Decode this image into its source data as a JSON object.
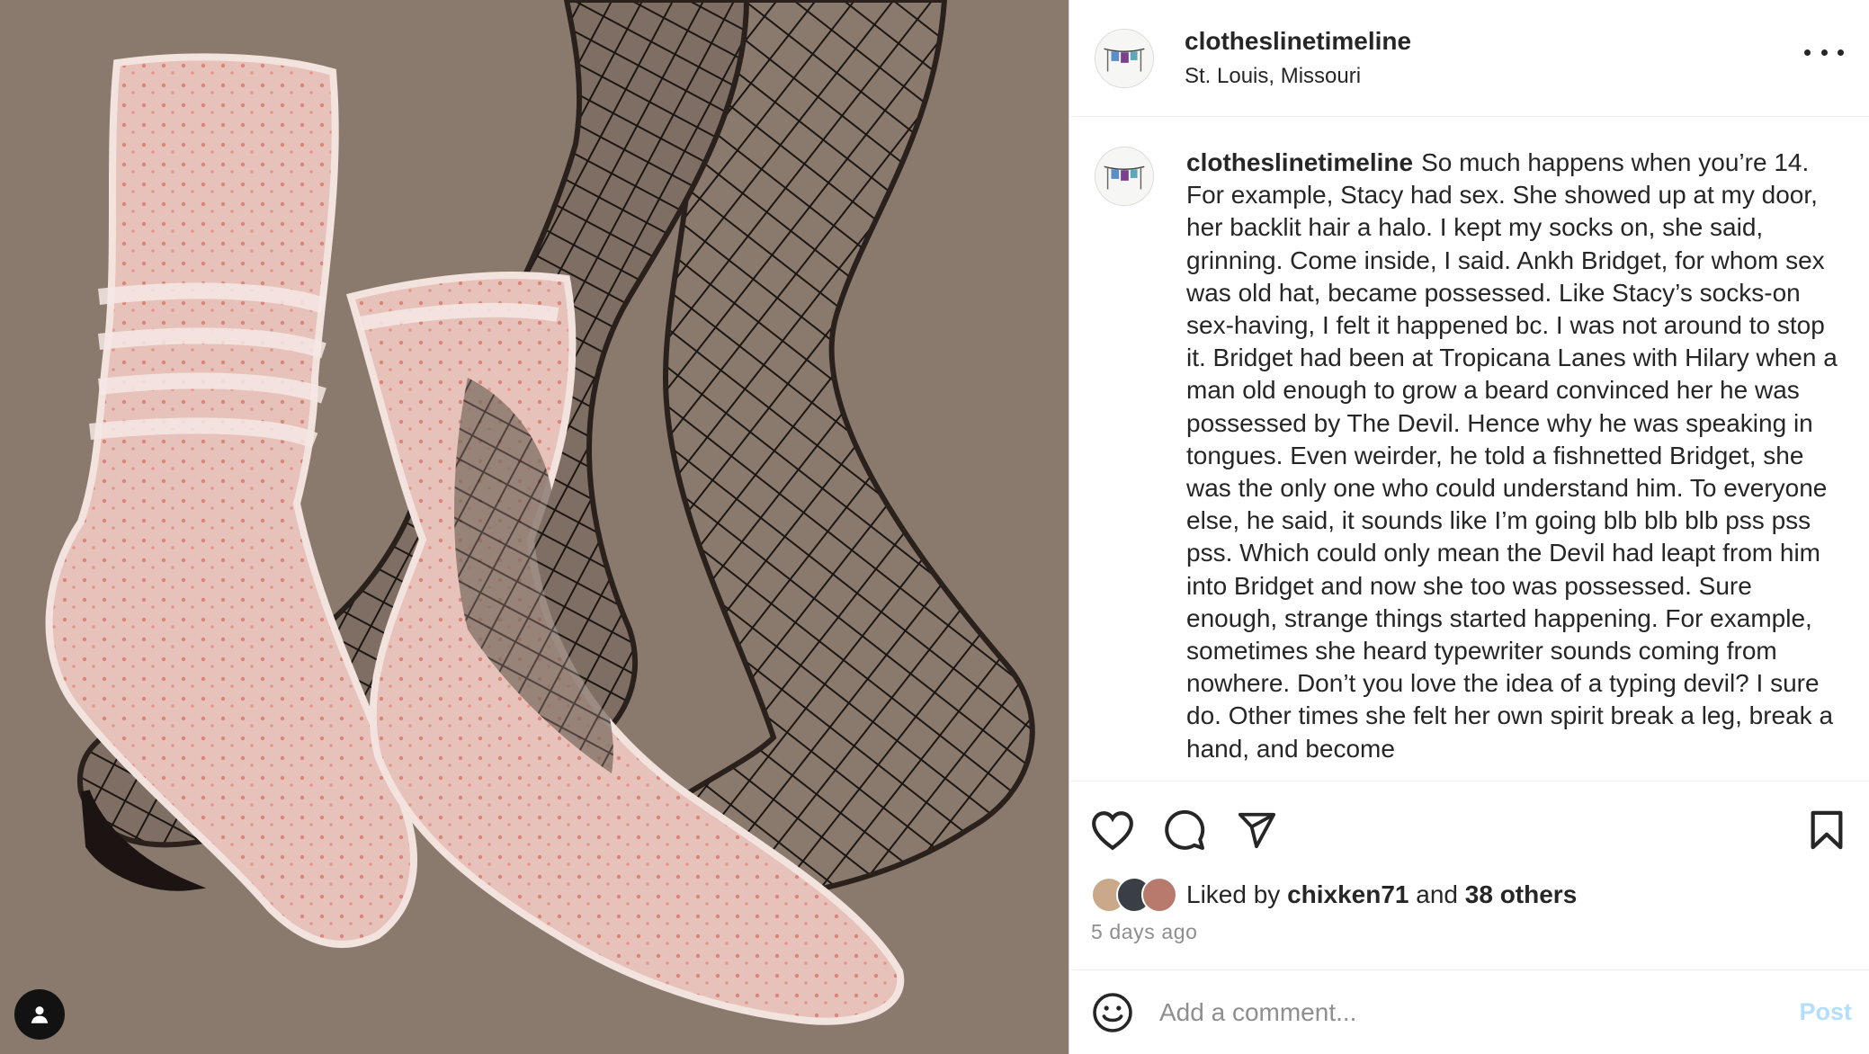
{
  "post": {
    "username": "clotheslinetimeline",
    "location": "St. Louis, Missouri",
    "more_icon": "more-horizontal-icon"
  },
  "caption": {
    "username": "clotheslinetimeline",
    "text": "So much happens when you’re 14. For example, Stacy had sex. She showed up at my door, her backlit hair a halo. I kept my socks on, she said, grinning. Come inside, I said. Ankh Bridget, for whom sex was old hat, became possessed. Like Stacy’s socks-on sex-having, I felt it happened bc. I was not around to stop it. Bridget had been at Tropicana Lanes with Hilary when a man old enough to grow a beard convinced her he was possessed by The Devil. Hence why he was speaking in tongues. Even weirder, he told a fishnetted Bridget, she was the only one who could understand him. To everyone else, he said, it sounds like I’m going blb blb blb pss pss pss. Which could only mean the Devil had leapt from him into Bridget and now she too was possessed. Sure enough, strange things started happening. For example, sometimes she heard typewriter sounds coming from nowhere. Don’t you love the idea of a typing devil? I sure do. Other times she felt her own spirit break a leg, break a hand, and become"
  },
  "actions": {
    "like_icon": "heart-icon",
    "comment_icon": "comment-icon",
    "share_icon": "send-icon",
    "save_icon": "bookmark-icon"
  },
  "likes": {
    "prefix": "Liked by",
    "user": "chixken71",
    "conjunction": "and",
    "others": "38 others"
  },
  "timestamp": "5 days ago",
  "comment": {
    "placeholder": "Add a comment...",
    "post_label": "Post",
    "emoji_icon": "emoji-smile-icon"
  },
  "media": {
    "tag_icon": "user-tag-icon",
    "background_color": "#8a7a6e"
  },
  "colors": {
    "post_button_disabled": "#b2dffc",
    "secondary_text": "#8e8e8e"
  }
}
